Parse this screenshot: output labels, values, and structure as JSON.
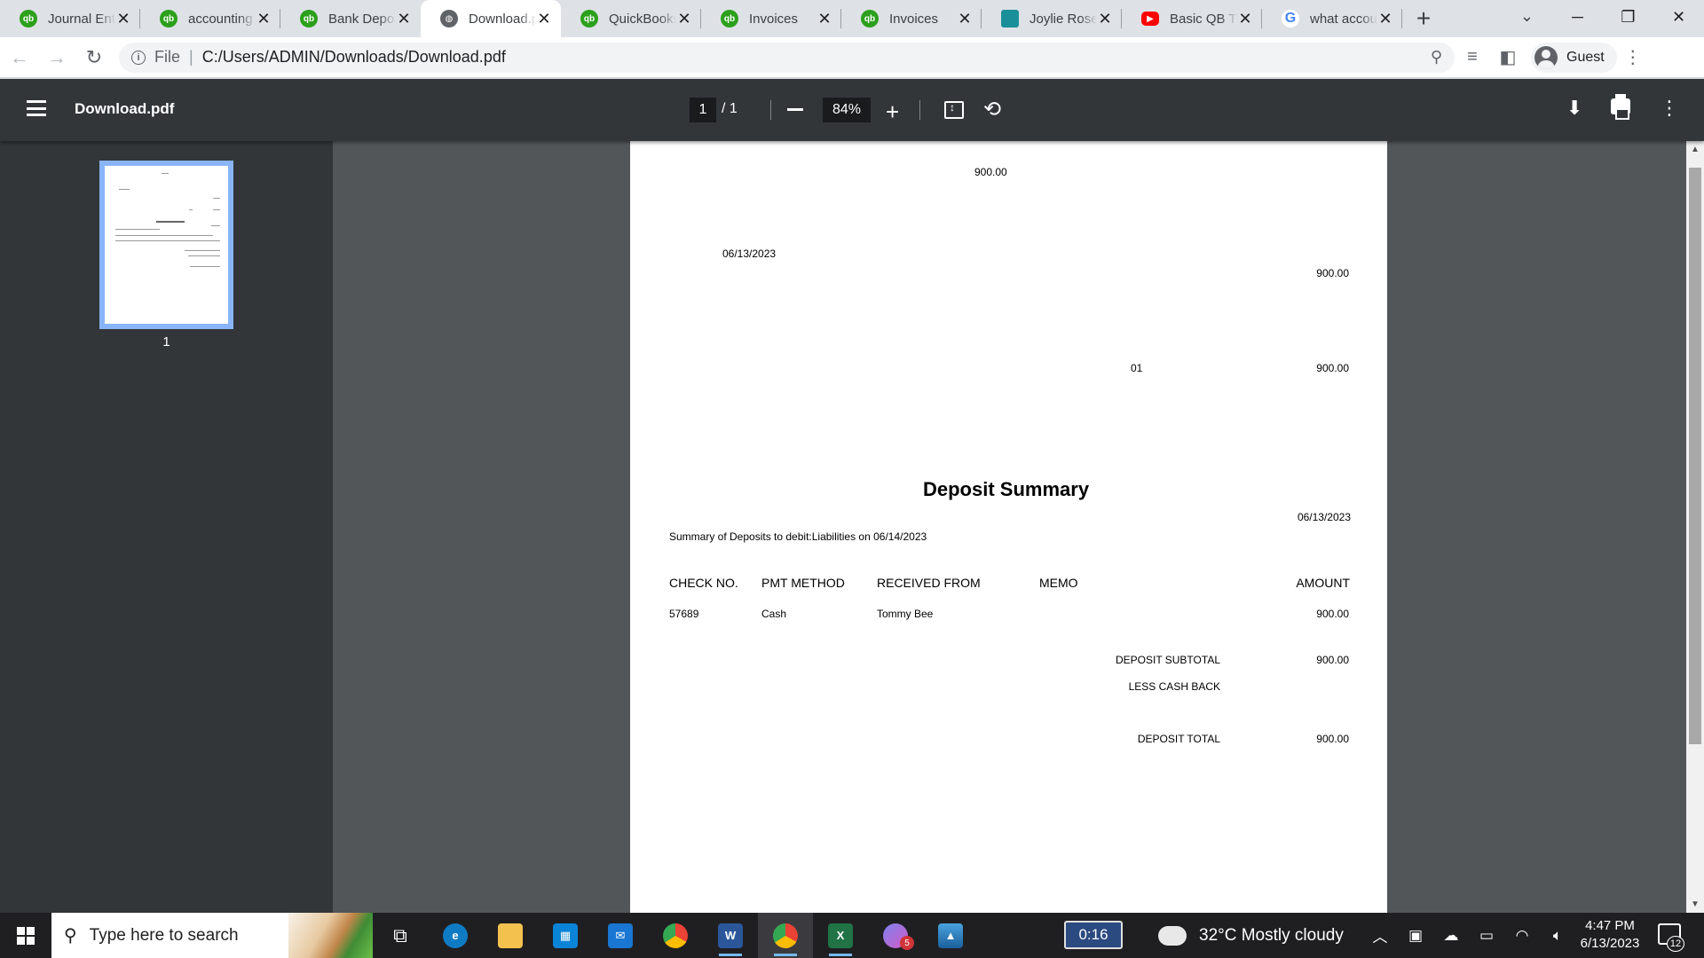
{
  "browser": {
    "tabs": [
      {
        "title": "Journal Entr",
        "favicon": "qb-icon"
      },
      {
        "title": "accounting",
        "favicon": "qb-icon"
      },
      {
        "title": "Bank Depos",
        "favicon": "qb-icon"
      },
      {
        "title": "Download.p",
        "favicon": "globe-icon",
        "active": true
      },
      {
        "title": "QuickBooks",
        "favicon": "qb-icon"
      },
      {
        "title": "Invoices",
        "favicon": "qb-icon"
      },
      {
        "title": "Invoices",
        "favicon": "qb-icon"
      },
      {
        "title": "Joylie Rose",
        "favicon": "joylie-icon"
      },
      {
        "title": "Basic QB Tu",
        "favicon": "youtube-icon"
      },
      {
        "title": "what accou",
        "favicon": "google-icon"
      }
    ],
    "address": {
      "scheme": "File",
      "url": "C:/Users/ADMIN/Downloads/Download.pdf"
    },
    "profile_label": "Guest"
  },
  "pdf_viewer": {
    "file_name": "Download.pdf",
    "current_page": "1",
    "total_pages": "/ 1",
    "zoom": "84%",
    "thumbnail_label": "1"
  },
  "document": {
    "top_amount": "900.00",
    "date_left": "06/13/2023",
    "amount_right_1": "900.00",
    "code": "01",
    "amount_right_2": "900.00",
    "title": "Deposit Summary",
    "summary_date": "06/13/2023",
    "summary_text": "Summary of Deposits to debit:Liabilities on 06/14/2023",
    "columns": {
      "check_no": "CHECK NO.",
      "pmt_method": "PMT METHOD",
      "received_from": "RECEIVED FROM",
      "memo": "MEMO",
      "amount": "AMOUNT"
    },
    "rows": [
      {
        "check_no": "57689",
        "pmt_method": "Cash",
        "received_from": "Tommy Bee",
        "memo": "",
        "amount": "900.00"
      }
    ],
    "deposit_subtotal_label": "DEPOSIT SUBTOTAL",
    "deposit_subtotal": "900.00",
    "less_cash_back_label": "LESS CASH BACK",
    "deposit_total_label": "DEPOSIT TOTAL",
    "deposit_total": "900.00"
  },
  "taskbar": {
    "search_placeholder": "Type here to search",
    "timer": "0:16",
    "weather": "32°C  Mostly cloudy",
    "time": "4:47 PM",
    "date": "6/13/2023",
    "notification_count": "12",
    "teams_badge": "5"
  },
  "colors": {
    "qb_green": "#2ca01c",
    "pdf_toolbar": "#323639",
    "pdf_canvas": "#525659",
    "thumb_border": "#8ab4f8"
  }
}
